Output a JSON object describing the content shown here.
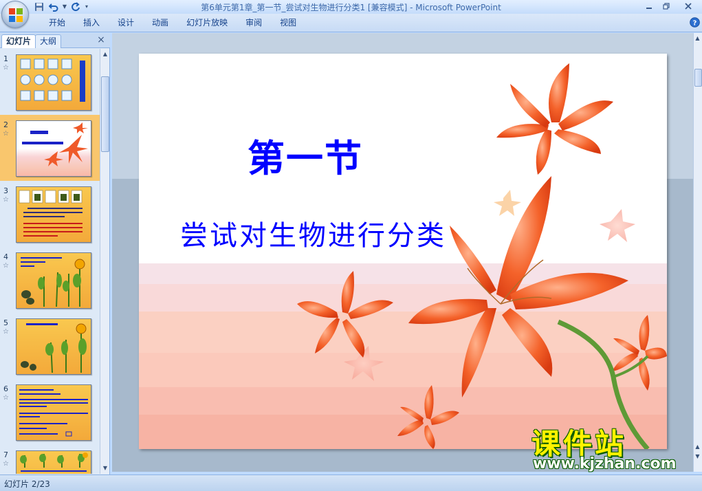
{
  "window": {
    "title": "第6单元第1章_第一节_尝试对生物进行分类1 [兼容模式]",
    "app_name": "Microsoft PowerPoint"
  },
  "ribbon": {
    "tabs": [
      "开始",
      "插入",
      "设计",
      "动画",
      "幻灯片放映",
      "审阅",
      "视图"
    ]
  },
  "left_pane": {
    "tabs": {
      "slides": "幻灯片",
      "outline": "大纲"
    },
    "thumbnails": [
      {
        "number": "1",
        "selected": false
      },
      {
        "number": "2",
        "selected": true
      },
      {
        "number": "3",
        "selected": false
      },
      {
        "number": "4",
        "selected": false
      },
      {
        "number": "5",
        "selected": false
      },
      {
        "number": "6",
        "selected": false
      },
      {
        "number": "7",
        "selected": false
      }
    ]
  },
  "slide": {
    "title": "第一节",
    "subtitle": "尝试对生物进行分类"
  },
  "watermark": {
    "brand": "课件站",
    "url": "www.kjzhan.com"
  },
  "status_bar": {
    "slide_indicator": "幻灯片 2/23"
  },
  "colors": {
    "title_text": "#0000ff",
    "selection": "#f9c66d",
    "watermark_text": "#fff200"
  }
}
